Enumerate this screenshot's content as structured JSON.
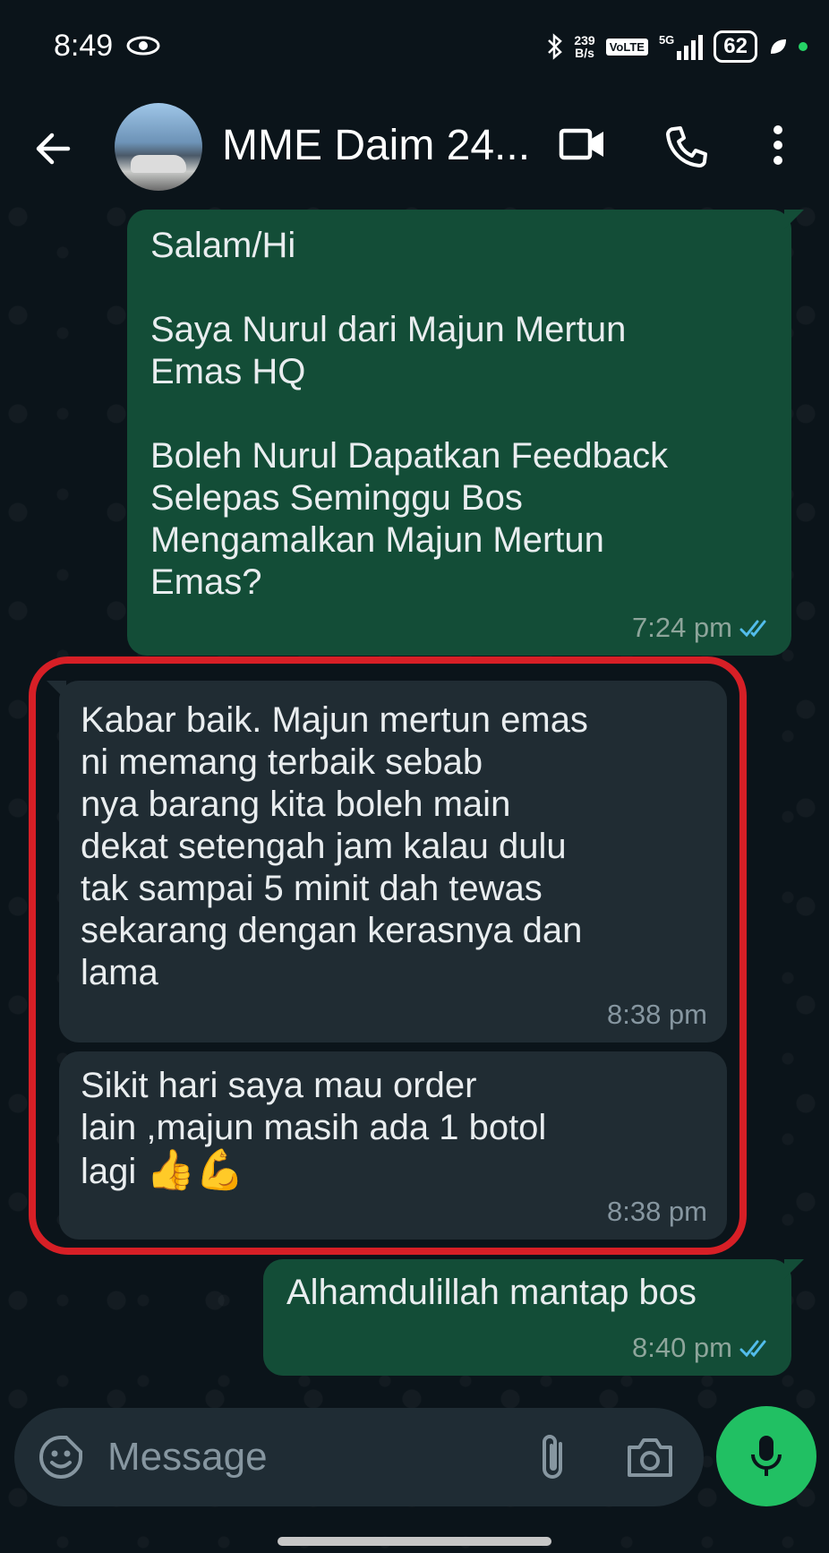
{
  "status_bar": {
    "time": "8:49",
    "speed_value": "239",
    "speed_unit": "B/s",
    "volte": "VoLTE",
    "network": "5G",
    "battery": "62"
  },
  "header": {
    "contact_name": "MME Daim 24..."
  },
  "messages": [
    {
      "direction": "outgoing",
      "text": "Salam/Hi\n\nSaya Nurul dari Majun Mertun\nEmas HQ\n\nBoleh Nurul Dapatkan Feedback\nSelepas Seminggu Bos\nMengamalkan Majun Mertun\nEmas?",
      "time": "7:24 pm",
      "status": "read"
    },
    {
      "direction": "incoming",
      "text": "Kabar baik.  Majun mertun emas\nni memang  terbaik  sebab\nnya barang kita boleh main\ndekat setengah jam  kalau dulu\ntak sampai 5 minit dah tewas\nsekarang dengan kerasnya  dan\nlama",
      "time": "8:38 pm"
    },
    {
      "direction": "incoming",
      "text": "Sikit hari saya mau order\nlain  ,majun masih ada 1 botol\nlagi ",
      "emoji": "👍💪",
      "time": "8:38 pm"
    },
    {
      "direction": "outgoing",
      "text": "Alhamdulillah mantap bos",
      "time": "8:40 pm",
      "status": "read"
    }
  ],
  "composer": {
    "placeholder": "Message"
  },
  "colors": {
    "outgoing_bubble": "#134d37",
    "incoming_bubble": "#202c33",
    "highlight_border": "#d71f26",
    "mic_button": "#21c063",
    "read_tick": "#53bdeb"
  }
}
